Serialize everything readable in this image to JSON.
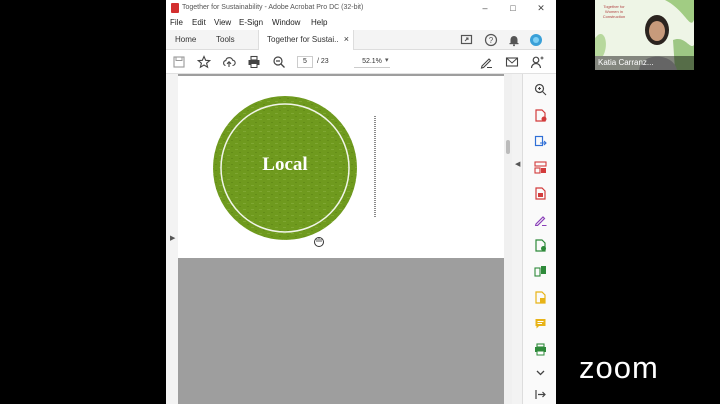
{
  "window": {
    "title": "Together for Sustainability - Adobe Acrobat Pro DC (32-bit)",
    "controls": [
      "–",
      "□",
      "✕"
    ]
  },
  "menu": [
    "File",
    "Edit",
    "View",
    "E-Sign",
    "Window",
    "Help"
  ],
  "tabs": {
    "home": "Home",
    "tools": "Tools",
    "document": "Together for Sustai...",
    "close": "×"
  },
  "toolbar": {
    "page_current": "5",
    "page_total": "/ 23",
    "zoom": "52.1%"
  },
  "document": {
    "circle_text": "Local",
    "circle_color": "#6f9a1e"
  },
  "participant": {
    "name": "Katia Carranz...",
    "logo_text": [
      "Together for",
      "Women in",
      "Construction"
    ]
  },
  "zoom_logo": "zoom",
  "colors": {
    "adobe_red": "#d32f2f",
    "icon_red": "#d23b3b",
    "icon_blue": "#2f6fd6",
    "icon_green": "#2e8a3a",
    "icon_purple": "#8a3fb8",
    "icon_yellow": "#e8b317"
  }
}
